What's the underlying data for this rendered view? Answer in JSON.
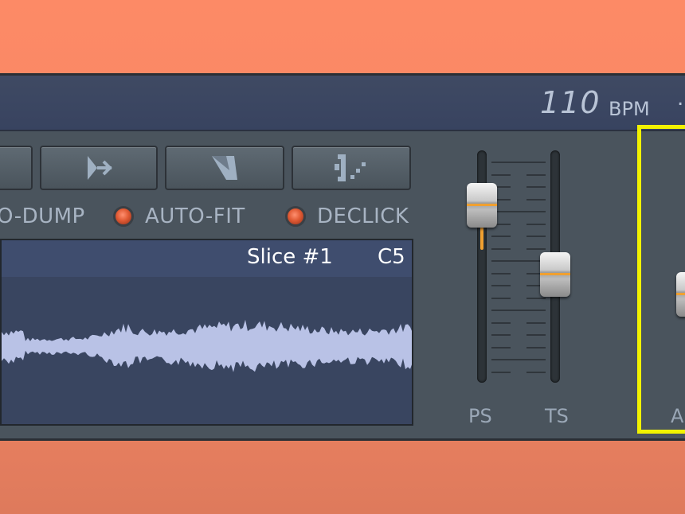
{
  "header": {
    "bpm_value": "110",
    "bpm_label": "BPM",
    "edge_text": "."
  },
  "toolbar": {
    "buttons": [
      {
        "name": "partial-button-icon"
      },
      {
        "name": "split-arrow-icon"
      },
      {
        "name": "trim-shape-icon"
      },
      {
        "name": "slice-grid-icon"
      }
    ]
  },
  "options": {
    "auto_dump": {
      "label": "O-DUMP"
    },
    "auto_fit": {
      "label": "AUTO-FIT"
    },
    "declick": {
      "label": "DECLICK"
    }
  },
  "waveform": {
    "slice_label": "Slice #1",
    "note_label": "C5",
    "wave_color": "#b9c2e6"
  },
  "faders": {
    "ps": {
      "label": "PS",
      "level": 0.87
    },
    "ts": {
      "label": "TS",
      "level": 0.5
    },
    "a": {
      "label": "A"
    }
  },
  "colors": {
    "accent": "#f0a030",
    "highlight": "#f2f200",
    "led": "#e05a34"
  }
}
